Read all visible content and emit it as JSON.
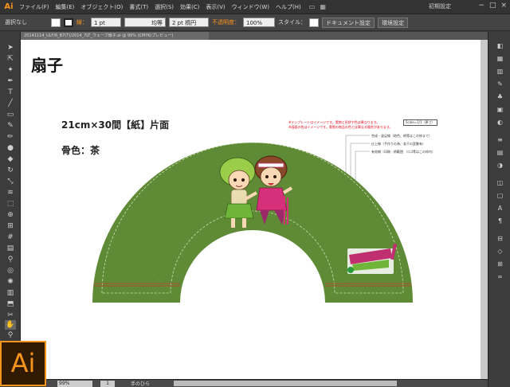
{
  "app": {
    "logo": "Ai",
    "menu": [
      "ファイル(F)",
      "編集(E)",
      "オブジェクト(O)",
      "書式(T)",
      "選択(S)",
      "効果(C)",
      "表示(V)",
      "ウィンドウ(W)",
      "ヘルプ(H)"
    ],
    "workspace": "初期設定",
    "window_controls": [
      "−",
      "□",
      "×"
    ]
  },
  "control_bar": {
    "selection": "選択なし",
    "stroke_label": "線：",
    "stroke_value": "1 pt",
    "stroke_style": "均等",
    "brush": "2 pt 楕円",
    "opacity_label": "不透明度：",
    "opacity_value": "100%",
    "style_label": "スタイル：",
    "doc_setup": "ドキュメント設定",
    "prefs": "環境設定"
  },
  "document_tab": "20141114_ULF/6_B7(T)/2014_7LT_ウェーブ扇子.ai @ 99% (CMYK/プレビュー)",
  "artboard": {
    "title": "扇子",
    "spec_size": "21cm×30間【紙】片面",
    "spec_color": "骨色：茶",
    "note1": "※テンプレートはイメージです。実物と形状や色は異なります。",
    "note2": "※画面の色はイメージです。実際の商品の色とは異なる場合があります。",
    "scale": "Scale=1/1（原寸）",
    "legend": [
      "完成・塗足線（地色、柄等はこの枠まで）",
      "仕上線（手作りの為、若干の変動有）",
      "有効線（印刷・柄範囲　ロゴ等はこの枠内）"
    ],
    "logo_text": "かたいくさ！千代田区！"
  },
  "status": {
    "zoom": "99%",
    "page": "1",
    "tool": "手のひら"
  },
  "colors": {
    "fan": "#5f8a36",
    "accent": "#f7941d",
    "red_line": "#c0392b"
  }
}
